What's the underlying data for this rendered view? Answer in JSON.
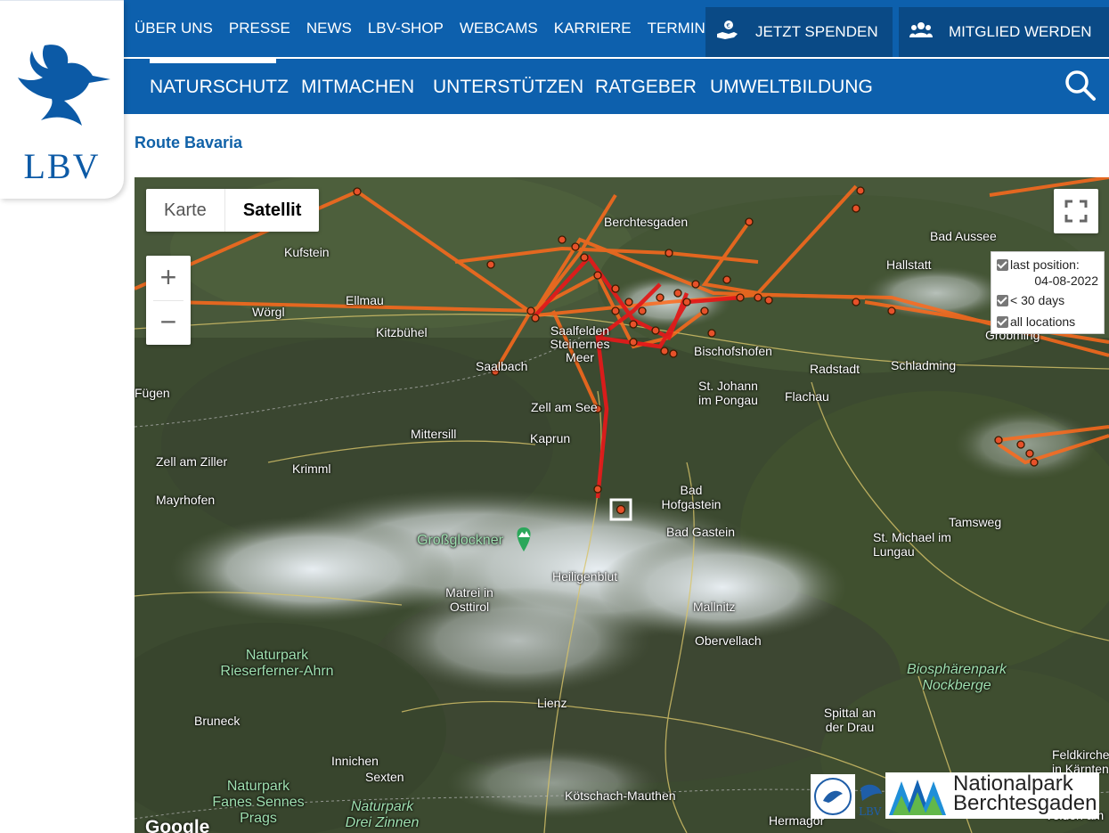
{
  "logo": {
    "text": "LBV"
  },
  "topnav": {
    "items": [
      "ÜBER UNS",
      "PRESSE",
      "NEWS",
      "LBV-SHOP",
      "WEBCAMS",
      "KARRIERE",
      "TERMINE"
    ],
    "donate_label": "JETZT SPENDEN",
    "member_label": "MITGLIED WERDEN"
  },
  "mainnav": {
    "items": [
      "NATURSCHUTZ",
      "MITMACHEN",
      "UNTERSTÜTZEN",
      "RATGEBER",
      "UMWELTBILDUNG"
    ],
    "active": "NATURSCHUTZ"
  },
  "page": {
    "title": "Route Bavaria"
  },
  "map": {
    "type_options": [
      "Karte",
      "Satellit"
    ],
    "type_selected": "Satellit",
    "zoom_in": "+",
    "zoom_out": "−",
    "legend": {
      "last_position_label": "last position:",
      "last_position_date": "04-08-2022",
      "recent_label": "< 30 days",
      "all_label": "all locations"
    },
    "places": [
      "Berchtesgaden",
      "Bad Aussee",
      "Kufstein",
      "Hallstatt",
      "Ellmau",
      "Wörgl",
      "Kitzbühel",
      "Saalfelden Steinernes Meer",
      "Saalbach",
      "Bischofshofen",
      "Radstadt",
      "Schladming",
      "Gröbming",
      "Fügen",
      "Zell am See",
      "St. Johann im Pongau",
      "Flachau",
      "Mittersill",
      "Kaprun",
      "Zell am Ziller",
      "Krimml",
      "Mayrhofen",
      "Bad Hofgastein",
      "Bad Gastein",
      "Tamsweg",
      "St. Michael im Lungau",
      "Großglockner",
      "Heiligenblut",
      "Matrei in Osttirol",
      "Mallnitz",
      "Obervellach",
      "Naturpark Rieserferner-Ahrn",
      "Biosphärenpark Nockberge",
      "Bruneck",
      "Lienz",
      "Spittal an der Drau",
      "Innichen",
      "Sexten",
      "Naturpark Fanes Sennes Prags",
      "Naturpark Drei Zinnen",
      "Kötschach-Mauthen",
      "Hermagor",
      "Feldkirchen in Kärnten",
      "Velden am"
    ],
    "partner_text": "Nationalpark Berchtesgaden",
    "attribution": "Google"
  }
}
